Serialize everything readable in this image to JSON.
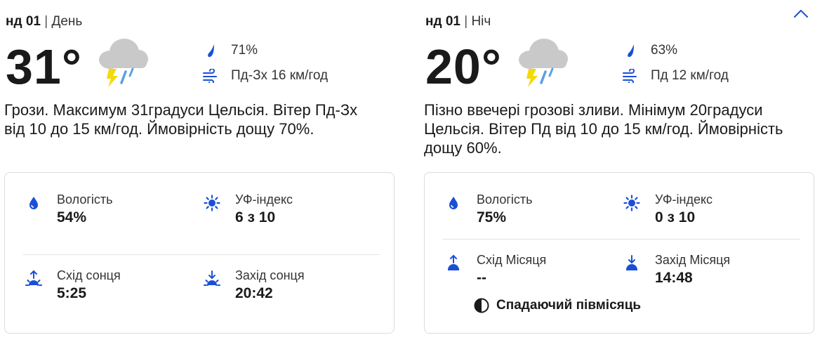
{
  "day": {
    "date": "нд 01",
    "separator": "|",
    "period": "День",
    "temperature": "31°",
    "weather_icon": "thunderstorm-cloud-icon",
    "precip_chance": "71%",
    "wind": "Пд-Зх 16 км/год",
    "description": "Грози. Максимум 31градуси Цельсія. Вітер Пд-Зх від 10 до 15 км/год. Ймовірність дощу 70%.",
    "details": {
      "humidity_label": "Вологість",
      "humidity_value": "54%",
      "uv_label": "УФ-індекс",
      "uv_value": "6 з 10",
      "sunrise_label": "Схід сонця",
      "sunrise_value": "5:25",
      "sunset_label": "Захід сонця",
      "sunset_value": "20:42"
    }
  },
  "night": {
    "date": "нд 01",
    "separator": "|",
    "period": "Ніч",
    "temperature": "20°",
    "weather_icon": "thunderstorm-cloud-icon",
    "precip_chance": "63%",
    "wind": "Пд 12 км/год",
    "description": "Пізно ввечері грозові зливи. Мінімум 20градуси Цельсія. Вітер Пд від 10 до 15 км/год. Ймовірність дощу 60%.",
    "details": {
      "humidity_label": "Вологість",
      "humidity_value": "75%",
      "uv_label": "УФ-індекс",
      "uv_value": "0 з 10",
      "moonrise_label": "Схід Місяця",
      "moonrise_value": "--",
      "moonset_label": "Захід Місяця",
      "moonset_value": "14:48",
      "moon_phase": "Спадаючий півмісяць"
    }
  },
  "colors": {
    "accent_blue": "#1a4fd6",
    "text": "#1a1a1a",
    "bolt": "#f5d90a",
    "cloud": "#c9c9c9"
  }
}
